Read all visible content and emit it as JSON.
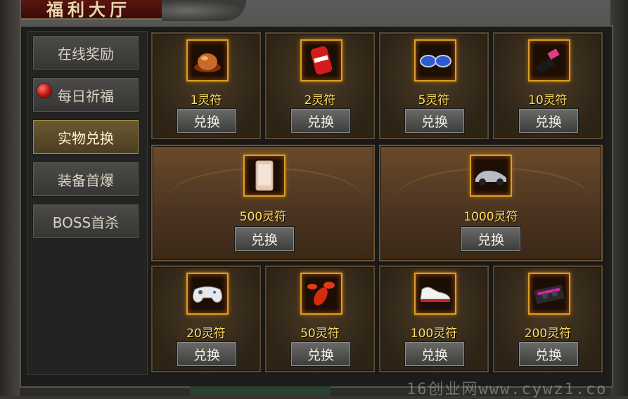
{
  "window": {
    "title": "福利大厅"
  },
  "sidebar": {
    "tabs": [
      {
        "label": "在线奖励",
        "active": false,
        "badge": false
      },
      {
        "label": "每日祈福",
        "active": false,
        "badge": true
      },
      {
        "label": "实物兑换",
        "active": true,
        "badge": false
      },
      {
        "label": "装备首爆",
        "active": false,
        "badge": false
      },
      {
        "label": "BOSS首杀",
        "active": false,
        "badge": false
      }
    ]
  },
  "rewards": {
    "top": [
      {
        "item": "egg-icon",
        "price": "1灵符",
        "button": "兑换"
      },
      {
        "item": "cola-can-icon",
        "price": "2灵符",
        "button": "兑换"
      },
      {
        "item": "sunglasses-icon",
        "price": "5灵符",
        "button": "兑换"
      },
      {
        "item": "lipstick-icon",
        "price": "10灵符",
        "button": "兑换"
      }
    ],
    "middle": [
      {
        "item": "smartphone-icon",
        "price": "500灵符",
        "button": "兑换"
      },
      {
        "item": "sports-car-icon",
        "price": "1000灵符",
        "button": "兑换"
      }
    ],
    "bottom": [
      {
        "item": "gamepad-icon",
        "price": "20灵符",
        "button": "兑换"
      },
      {
        "item": "lobster-icon",
        "price": "50灵符",
        "button": "兑换"
      },
      {
        "item": "sneaker-icon",
        "price": "100灵符",
        "button": "兑换"
      },
      {
        "item": "graphics-card-icon",
        "price": "200灵符",
        "button": "兑换"
      }
    ]
  },
  "watermark": "16创业网www.cywz1.co",
  "colors": {
    "price": "#ffe060",
    "active_tab": "#6b5a32",
    "icon_border": "#d8a020"
  }
}
